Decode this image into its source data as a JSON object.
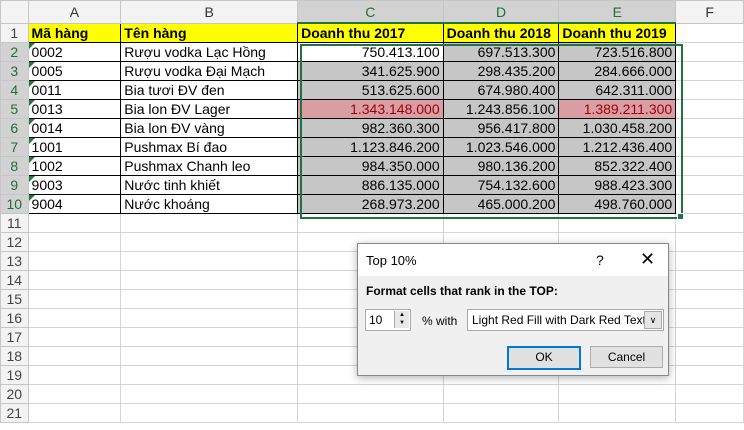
{
  "columns": [
    "A",
    "B",
    "C",
    "D",
    "E",
    "F"
  ],
  "headers": [
    "Mã hàng",
    "Tên hàng",
    "Doanh thu 2017",
    "Doanh thu 2018",
    "Doanh thu 2019"
  ],
  "rows": [
    [
      "0002",
      "Rượu vodka Lạc Hồng",
      "750.413.100",
      "697.513.300",
      "723.516.800"
    ],
    [
      "0005",
      "Rượu vodka Đại Mạch",
      "341.625.900",
      "298.435.200",
      "284.666.000"
    ],
    [
      "0011",
      "Bia tươi ĐV đen",
      "513.625.600",
      "674.980.400",
      "642.311.000"
    ],
    [
      "0013",
      "Bia lon ĐV Lager",
      "1.343.148.000",
      "1.243.856.100",
      "1.389.211.300"
    ],
    [
      "0014",
      "Bia lon ĐV vàng",
      "982.360.300",
      "956.417.800",
      "1.030.458.200"
    ],
    [
      "1001",
      "Pushmax Bí đao",
      "1.123.846.200",
      "1.023.546.000",
      "1.212.436.400"
    ],
    [
      "1002",
      "Pushmax Chanh leo",
      "984.350.000",
      "980.136.200",
      "852.322.400"
    ],
    [
      "9003",
      "Nước tinh khiết",
      "886.135.000",
      "754.132.600",
      "988.423.300"
    ],
    [
      "9004",
      "Nước khoáng",
      "268.973.200",
      "465.000.200",
      "498.760.000"
    ]
  ],
  "row_numbers": [
    "1",
    "2",
    "3",
    "4",
    "5",
    "6",
    "7",
    "8",
    "9",
    "10",
    "11",
    "12",
    "13",
    "14",
    "15",
    "16",
    "17",
    "18",
    "19",
    "20",
    "21"
  ],
  "dialog": {
    "title": "Top 10%",
    "help": "?",
    "close": "✕",
    "label": "Format cells that rank in the TOP:",
    "value": "10",
    "pct_with": "% with",
    "format": "Light Red Fill with Dark Red Text",
    "ok": "OK",
    "cancel": "Cancel"
  },
  "colors": {
    "header_fill": "#ffff00",
    "highlight_fill": "#d99ea3",
    "highlight_text": "#9c0006",
    "selection": "#217346"
  }
}
